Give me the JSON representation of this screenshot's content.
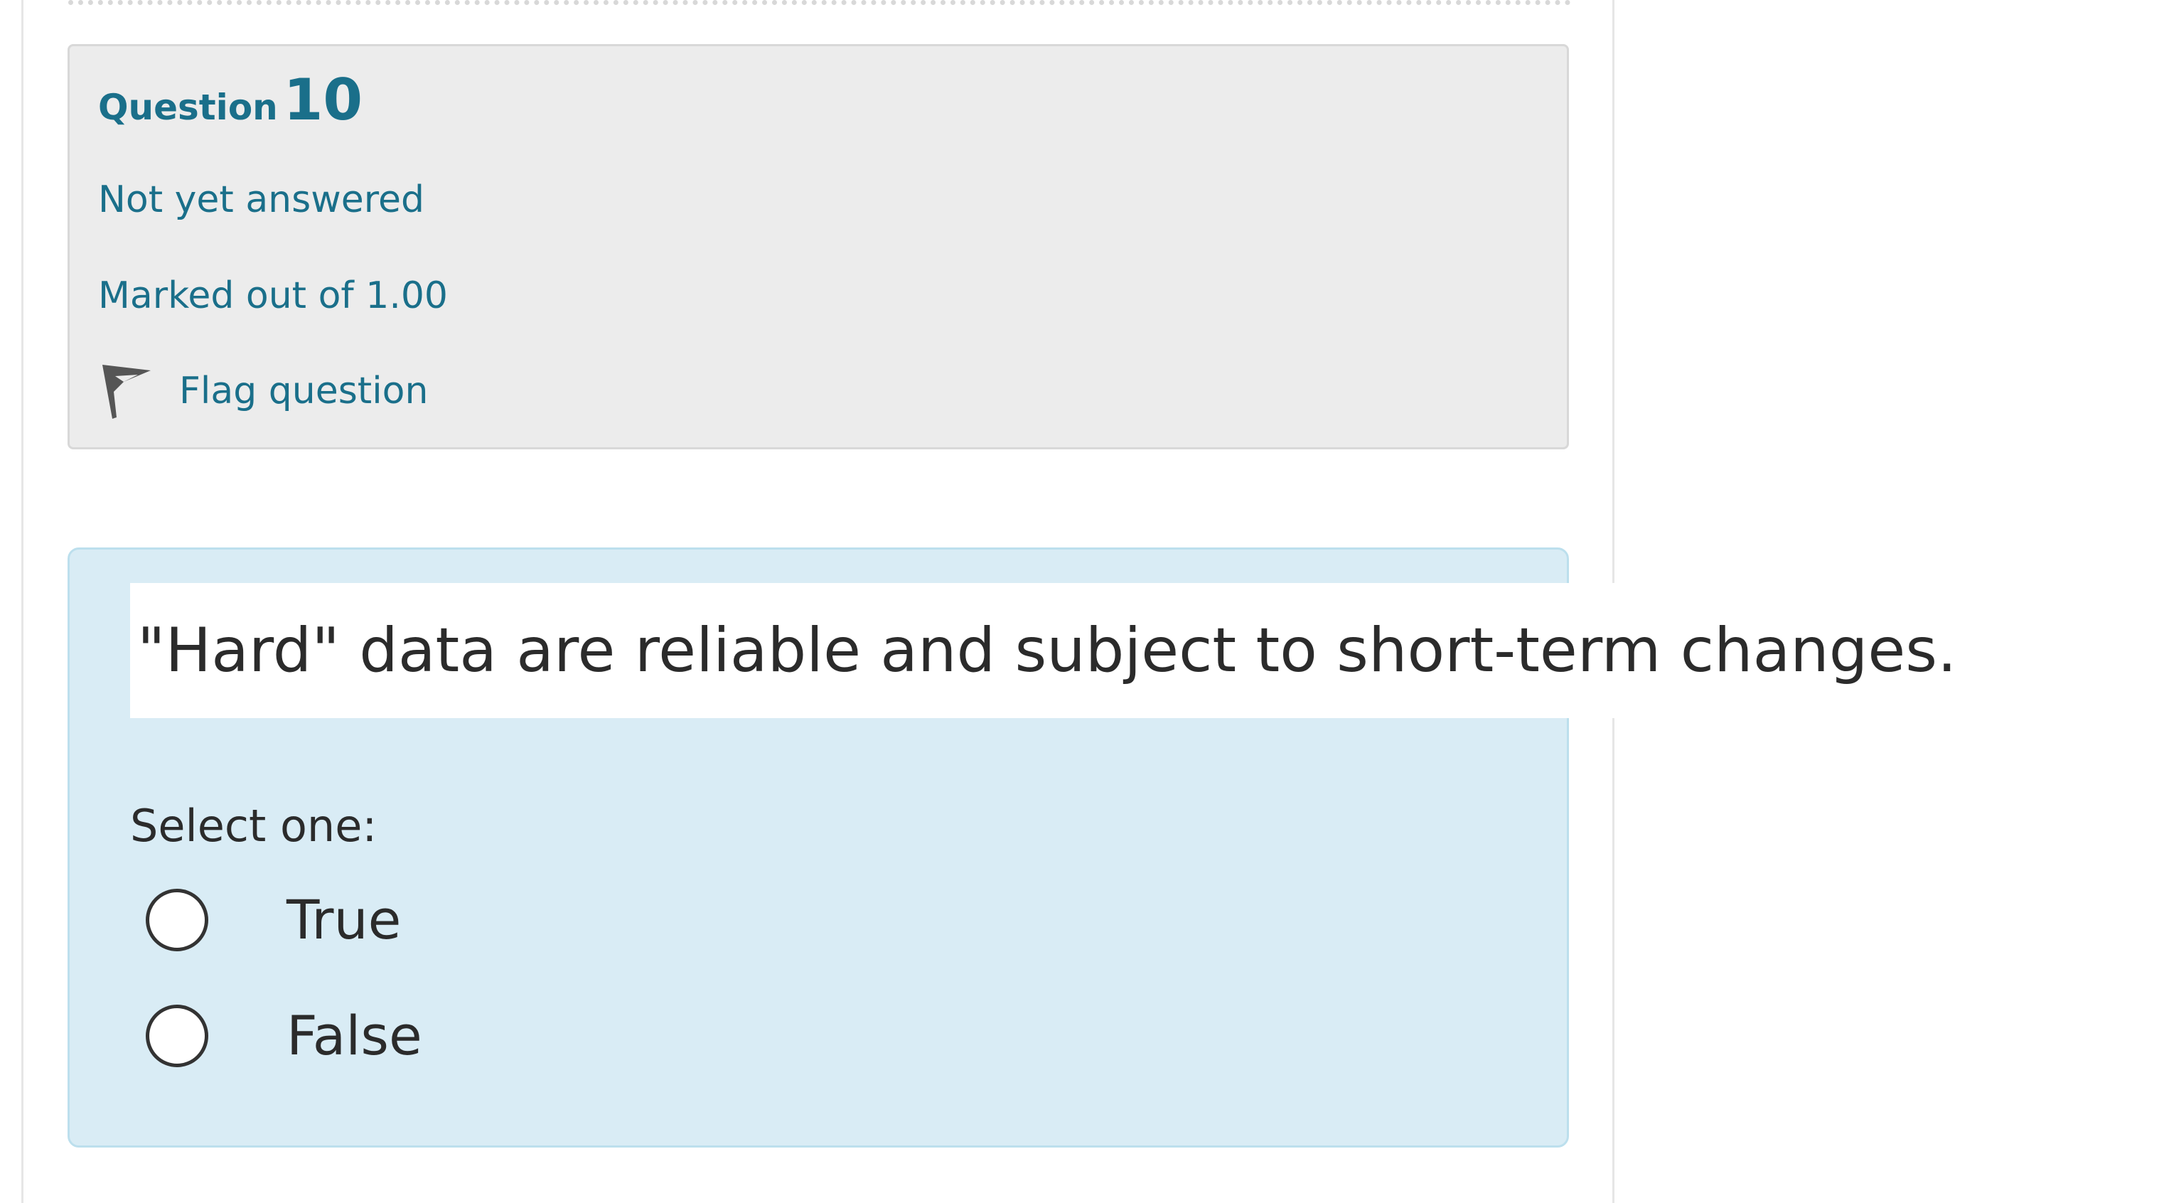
{
  "question_info": {
    "label": "Question",
    "number": "10",
    "state": "Not yet answered",
    "grade": "Marked out of 1.00",
    "flag": {
      "label": "Flag question",
      "icon": "flag-icon"
    }
  },
  "question": {
    "text": "\"Hard\" data are reliable and subject to short-term changes.",
    "prompt": "Select one:",
    "options": [
      {
        "label": "True",
        "selected": false
      },
      {
        "label": "False",
        "selected": false
      }
    ]
  },
  "colors": {
    "info_bg": "#ececec",
    "accent": "#1a6f8a",
    "answer_bg": "#d9ecf5"
  }
}
